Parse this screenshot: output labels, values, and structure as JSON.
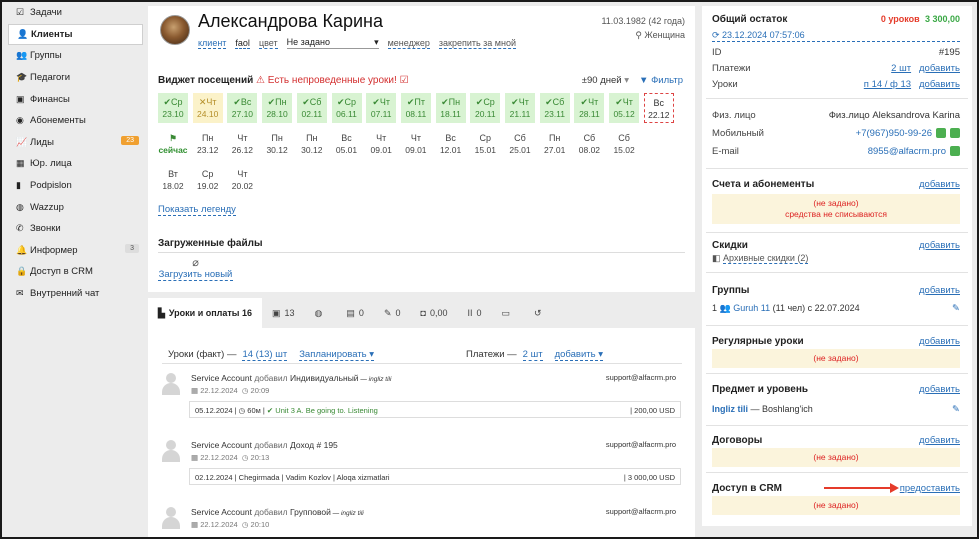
{
  "sidebar": [
    {
      "label": "Задачи",
      "icon": "tasks-icon",
      "glyph": "☑"
    },
    {
      "label": "Клиенты",
      "icon": "client-icon",
      "glyph": "👤",
      "active": true
    },
    {
      "label": "Группы",
      "icon": "groups-icon",
      "glyph": "👥"
    },
    {
      "label": "Педагоги",
      "icon": "teacher-icon",
      "glyph": "🎓"
    },
    {
      "label": "Финансы",
      "icon": "finance-icon",
      "glyph": "▣"
    },
    {
      "label": "Абонементы",
      "icon": "subscription-icon",
      "glyph": "◉"
    },
    {
      "label": "Лиды",
      "icon": "leads-icon",
      "glyph": "📈",
      "badge": "23",
      "badge_color": "#f0a030"
    },
    {
      "label": "Юр. лица",
      "icon": "legal-icon",
      "glyph": "▦"
    },
    {
      "label": "Podpislon",
      "icon": "doc-icon",
      "glyph": "▮"
    },
    {
      "label": "Wazzup",
      "icon": "whatsapp-icon",
      "glyph": "◍"
    },
    {
      "label": "Звонки",
      "icon": "phone-icon",
      "glyph": "✆"
    },
    {
      "label": "Информер",
      "icon": "bell-icon",
      "glyph": "🔔",
      "badge": "3",
      "badge_color": "#ddd"
    },
    {
      "label": "Доступ в CRM",
      "icon": "lock-icon",
      "glyph": "🔒"
    },
    {
      "label": "Внутренний чат",
      "icon": "chat-icon",
      "glyph": "✉"
    }
  ],
  "client": {
    "name": "Александрова Карина",
    "type_label": "клиент",
    "faol": "faol",
    "color_label": "цвет",
    "select_value": "Не задано",
    "manager_label": "менеджер",
    "assign_label": "закрепить за мной",
    "dob": "11.03.1982 (42 года)",
    "gender": "⚲ Женщина"
  },
  "widget": {
    "title": "Виджет посещений",
    "warning": "⚠ Есть непроведенные уроки! ☑",
    "period": "±90 дней",
    "filter": "Фильтр",
    "legend_link": "Показать легенду",
    "cells": [
      {
        "d": "Ср",
        "t": "23.10",
        "s": "g"
      },
      {
        "d": "Чт",
        "t": "24.10",
        "s": "y"
      },
      {
        "d": "Вс",
        "t": "27.10",
        "s": "g"
      },
      {
        "d": "Пн",
        "t": "28.10",
        "s": "g"
      },
      {
        "d": "Сб",
        "t": "02.11",
        "s": "g"
      },
      {
        "d": "Ср",
        "t": "06.11",
        "s": "g"
      },
      {
        "d": "Чт",
        "t": "07.11",
        "s": "g"
      },
      {
        "d": "Пт",
        "t": "08.11",
        "s": "g"
      },
      {
        "d": "Пн",
        "t": "18.11",
        "s": "g"
      },
      {
        "d": "Ср",
        "t": "20.11",
        "s": "g"
      },
      {
        "d": "Чт",
        "t": "21.11",
        "s": "g"
      },
      {
        "d": "Сб",
        "t": "23.11",
        "s": "g"
      },
      {
        "d": "Чт",
        "t": "28.11",
        "s": "g"
      },
      {
        "d": "Чт",
        "t": "05.12",
        "s": "g"
      },
      {
        "d": "Вс",
        "t": "22.12",
        "s": "red"
      },
      {
        "d": "",
        "t": "сейчас",
        "s": "now"
      },
      {
        "d": "Пн",
        "t": "23.12",
        "s": "n"
      },
      {
        "d": "Чт",
        "t": "26.12",
        "s": "n"
      },
      {
        "d": "Пн",
        "t": "30.12",
        "s": "n"
      },
      {
        "d": "Пн",
        "t": "30.12",
        "s": "n"
      },
      {
        "d": "Вс",
        "t": "05.01",
        "s": "n"
      },
      {
        "d": "Чт",
        "t": "09.01",
        "s": "n"
      },
      {
        "d": "Чт",
        "t": "09.01",
        "s": "n"
      },
      {
        "d": "Вс",
        "t": "12.01",
        "s": "n"
      },
      {
        "d": "Ср",
        "t": "15.01",
        "s": "n"
      },
      {
        "d": "Сб",
        "t": "25.01",
        "s": "n"
      },
      {
        "d": "Пн",
        "t": "27.01",
        "s": "n"
      },
      {
        "d": "Сб",
        "t": "08.02",
        "s": "n"
      },
      {
        "d": "Сб",
        "t": "15.02",
        "s": "n"
      },
      {
        "d": "Вт",
        "t": "18.02",
        "s": "n"
      },
      {
        "d": "Ср",
        "t": "19.02",
        "s": "n"
      },
      {
        "d": "Чт",
        "t": "20.02",
        "s": "n"
      }
    ]
  },
  "files": {
    "title": "Загруженные файлы",
    "upload": "Загрузить новый"
  },
  "tabs": [
    {
      "label": "Уроки и оплаты 16",
      "icon": "lessons-icon",
      "glyph": "▙",
      "active": true
    },
    {
      "label": "13",
      "icon": "notes-icon",
      "glyph": "▣"
    },
    {
      "label": "",
      "icon": "whatsapp-icon",
      "glyph": "◍"
    },
    {
      "label": "0",
      "icon": "doc-icon",
      "glyph": "▤"
    },
    {
      "label": "0",
      "icon": "sms-icon",
      "glyph": "✎"
    },
    {
      "label": "0,00",
      "icon": "wallet-icon",
      "glyph": "◘"
    },
    {
      "label": "0",
      "icon": "pause-icon",
      "glyph": "II"
    },
    {
      "label": "",
      "icon": "cash-icon",
      "glyph": "▭"
    },
    {
      "label": "",
      "icon": "history-icon",
      "glyph": "↺"
    }
  ],
  "lessons": {
    "fact_label": "Уроки (факт) —",
    "fact_value": "14 (13) шт",
    "planned": "Запланировать ▾",
    "payments_label": "Платежи —",
    "payments_value": "2 шт",
    "add": "добавить ▾",
    "entries": [
      {
        "actor": "Service Account",
        "action": " добавил ",
        "what": "Индивидуальный",
        "sub": " — ingliz tili",
        "date": "22.12.2024",
        "time": "20:09",
        "email": "support@alfacrm.pro",
        "box_left": "05.12.2024 | ◷ 60м | ",
        "box_lesson": "✔ Unit 3 A. Be going to. Listening",
        "box_amount": "| 200,00 USD"
      },
      {
        "actor": "Service Account",
        "action": " добавил ",
        "what": "Доход # 195",
        "sub": "",
        "date": "22.12.2024",
        "time": "20:13",
        "email": "support@alfacrm.pro",
        "box_left": "02.12.2024 | Chegirmada | Vadim Kozlov | Aloqa xizmatlari",
        "box_lesson": "",
        "box_amount": "| 3 000,00 USD"
      },
      {
        "actor": "Service Account",
        "action": " добавил ",
        "what": "Групповой",
        "sub": " — ingliz tili",
        "date": "22.12.2024",
        "time": "20:10",
        "email": "support@alfacrm.pro",
        "box_left": "",
        "box_lesson": "",
        "box_amount": ""
      }
    ]
  },
  "right": {
    "balance_title": "Общий остаток",
    "balance_lessons": "0 уроков",
    "balance_amount": "3 300,00",
    "updated": "⟳ 23.12.2024 07:57:06",
    "id_label": "ID",
    "id_value": "#195",
    "payments_label": "Платежи",
    "payments_value": "2 шт",
    "payments_add": "добавить",
    "lessons_label": "Уроки",
    "lessons_value": "п 14 / ф 13",
    "lessons_add": "добавить",
    "person_label": "Физ. лицо",
    "person_value": "Физ.лицо Aleksandrova Karina",
    "mobile_label": "Мобильный",
    "mobile_value": "+7(967)950-99-26",
    "email_label": "E-mail",
    "email_value": "8955@alfacrm.pro",
    "accounts_title": "Счета и абонементы",
    "accounts_add": "добавить",
    "not_set": "(не задано)",
    "no_debit": "средства не списываются",
    "discounts_title": "Скидки",
    "discounts_add": "добавить",
    "archive": "Архивные скидки (2)",
    "groups_title": "Группы",
    "groups_add": "добавить",
    "group_count": "1",
    "group_name": "Guruh 11",
    "group_info": "(11 чел) с 22.07.2024",
    "regular_title": "Регулярные уроки",
    "regular_add": "добавить",
    "subject_title": "Предмет и уровень",
    "subject_add": "добавить",
    "subject_name": "Ingliz tili",
    "subject_level": " — Boshlang'ich",
    "contracts_title": "Договоры",
    "contracts_add": "добавить",
    "crm_title": "Доступ в CRM",
    "crm_grant": "предоставить",
    "colors": {
      "red": "#e53b2a",
      "green": "#3aa845",
      "link": "#2a6fb7"
    }
  }
}
